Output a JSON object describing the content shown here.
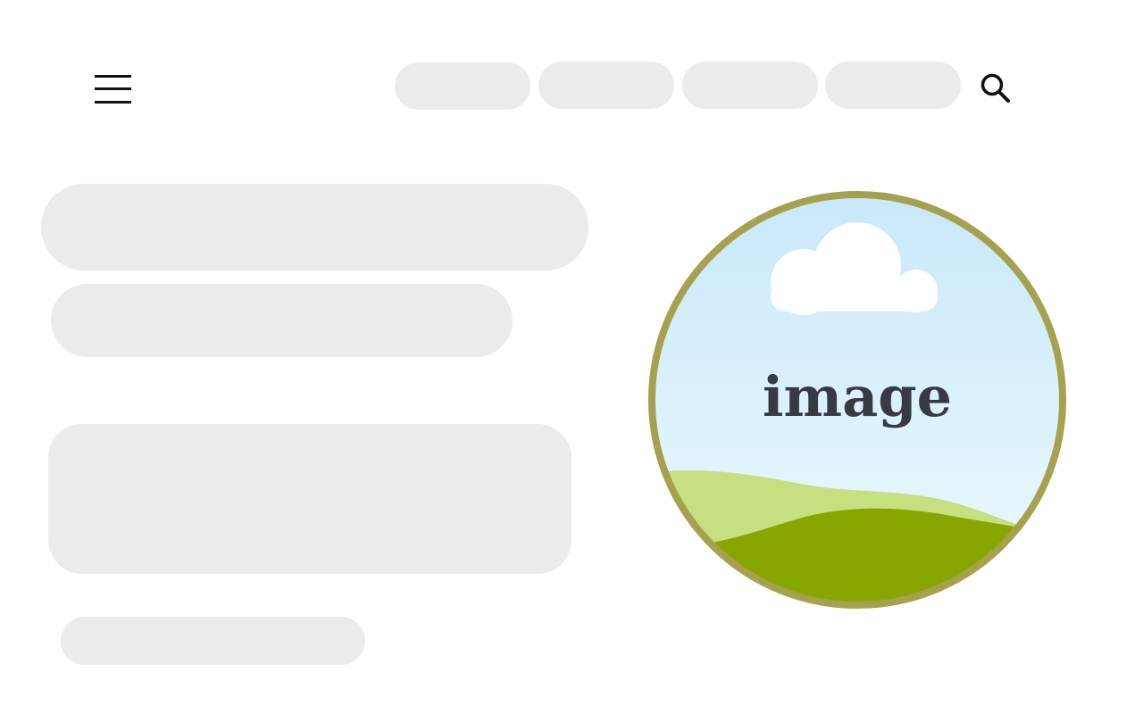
{
  "header": {
    "menu_icon": "hamburger-menu-icon",
    "nav_items": [
      "",
      "",
      "",
      ""
    ],
    "search_icon": "search-icon"
  },
  "content": {
    "placeholders": [
      "",
      "",
      "",
      ""
    ]
  },
  "hero_image": {
    "label": "image",
    "colors": {
      "border": "#a5a14f",
      "sky_top": "#c8e8fb",
      "sky_bottom": "#eef9fc",
      "cloud": "#ffffff",
      "hill_light": "#c5df81",
      "hill_dark": "#88a600",
      "text": "#363a44"
    }
  },
  "colors": {
    "placeholder": "#ebebeb",
    "background": "#ffffff"
  }
}
